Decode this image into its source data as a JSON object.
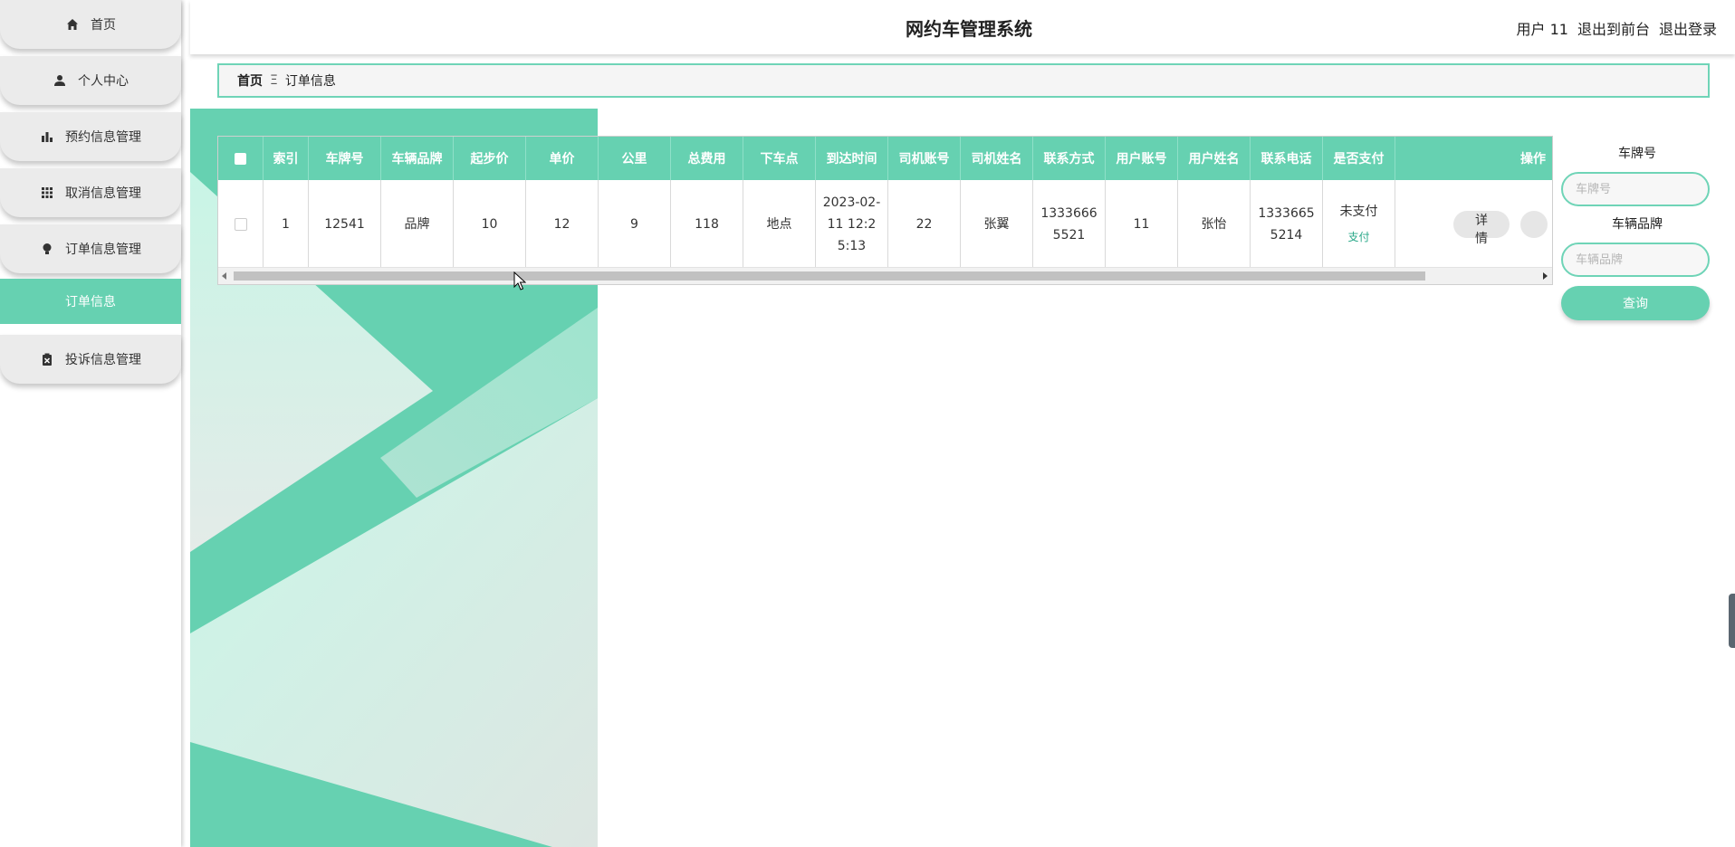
{
  "app": {
    "title": "网约车管理系统"
  },
  "header": {
    "user_label": "用户 11",
    "front_label": "退出到前台",
    "logout_label": "退出登录"
  },
  "sidebar": {
    "items": [
      {
        "label": "首页",
        "icon": "home-icon"
      },
      {
        "label": "个人中心",
        "icon": "user-icon"
      },
      {
        "label": "预约信息管理",
        "icon": "bar-chart-icon"
      },
      {
        "label": "取消信息管理",
        "icon": "grid-icon"
      },
      {
        "label": "订单信息管理",
        "icon": "bulb-icon"
      },
      {
        "label": "订单信息",
        "icon": "",
        "active": true
      },
      {
        "label": "投诉信息管理",
        "icon": "clipboard-icon"
      }
    ]
  },
  "breadcrumb": {
    "home": "首页",
    "separator": "Ξ",
    "current": "订单信息"
  },
  "table": {
    "headers": [
      "索引",
      "车牌号",
      "车辆品牌",
      "起步价",
      "单价",
      "公里",
      "总费用",
      "下车点",
      "到达时间",
      "司机账号",
      "司机姓名",
      "联系方式",
      "用户账号",
      "用户姓名",
      "联系电话",
      "是否支付",
      "操作"
    ],
    "rows": [
      {
        "index": "1",
        "plate": "12541",
        "brand": "品牌",
        "base_price": "10",
        "unit_price": "12",
        "km": "9",
        "total": "118",
        "dropoff": "地点",
        "arrival_time": "2023-02-11 12:25:13",
        "driver_account": "22",
        "driver_name": "张翼",
        "driver_phone": "13336665521",
        "user_account": "11",
        "user_name": "张怡",
        "user_phone": "13336655214",
        "paid_status": "未支付",
        "pay_link": "支付",
        "detail_button": "详情"
      }
    ]
  },
  "search": {
    "plate_label": "车牌号",
    "plate_placeholder": "车牌号",
    "brand_label": "车辆品牌",
    "brand_placeholder": "车辆品牌",
    "query_button": "查询"
  },
  "colors": {
    "accent": "#66d1b1",
    "sidebar_item_bg": "#ebebeb",
    "breadcrumb_border": "#6fd4b7"
  }
}
